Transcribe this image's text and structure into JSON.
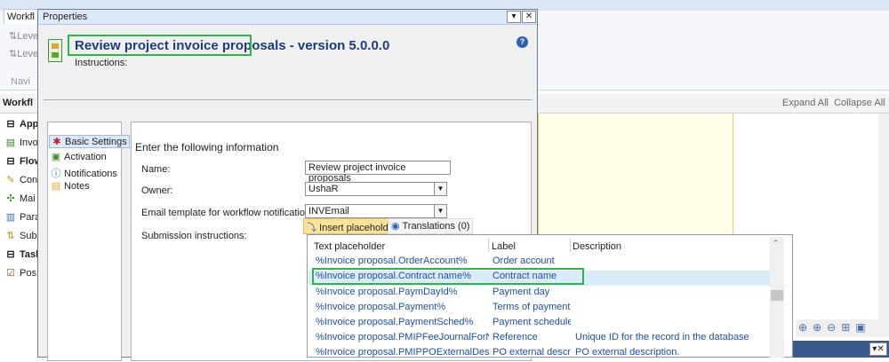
{
  "background": {
    "tab_label": "Workfl",
    "ribbon_items": [
      "Leve",
      "Leve"
    ],
    "nav_label": "Navi",
    "panel_title": "Workfl",
    "expand_all": "Expand All",
    "collapse_all": "Collapse All",
    "tree": [
      {
        "label": "App",
        "bold": true,
        "icon": "minus-box-icon"
      },
      {
        "label": "Invo",
        "bold": false,
        "icon": "document-icon"
      },
      {
        "label": "Flow",
        "bold": true,
        "icon": "minus-box-icon"
      },
      {
        "label": "Con",
        "bold": false,
        "icon": "pencil-icon"
      },
      {
        "label": "Mai",
        "bold": false,
        "icon": "tools-icon"
      },
      {
        "label": "Para",
        "bold": false,
        "icon": "param-icon"
      },
      {
        "label": "Sub",
        "bold": false,
        "icon": "subflow-icon"
      },
      {
        "label": "Task",
        "bold": true,
        "icon": "minus-box-icon"
      },
      {
        "label": "Pos",
        "bold": false,
        "icon": "checkbox-icon"
      }
    ],
    "zoom_icons": [
      "zoom-fit-icon",
      "zoom-in-icon",
      "zoom-out-icon",
      "fit-icon",
      "page-icon"
    ]
  },
  "dialog": {
    "title": "Properties",
    "heading": "Review project invoice proposals",
    "heading_suffix": " - version 5.0.0.0",
    "instructions_label": "Instructions:",
    "nav": [
      {
        "label": "Basic Settings",
        "icon": "star-icon",
        "selected": true
      },
      {
        "label": "Activation",
        "icon": "activation-icon",
        "selected": false
      },
      {
        "label": "Notifications",
        "icon": "info-icon",
        "selected": false
      },
      {
        "label": "Notes",
        "icon": "notes-icon",
        "selected": false
      }
    ],
    "section_title": "Enter the following information",
    "fields": {
      "name_label": "Name:",
      "name_value": "Review project invoice proposals",
      "owner_label": "Owner:",
      "owner_value": "UshaR",
      "email_label": "Email template for workflow notifications:",
      "email_value": "INVEmail",
      "submission_label": "Submission instructions:"
    },
    "toolbar": {
      "insert_placeholder": "Insert placeholder",
      "translations": "Translations (0)"
    }
  },
  "placeholder_list": {
    "headers": {
      "col1": "Text placeholder",
      "col2": "Label",
      "col3": "Description"
    },
    "rows": [
      {
        "placeholder": "%Invoice proposal.OrderAccount%",
        "label": "Order account",
        "description": ""
      },
      {
        "placeholder": "%Invoice proposal.Contract name%",
        "label": "Contract name",
        "description": ""
      },
      {
        "placeholder": "%Invoice proposal.PaymDayId%",
        "label": "Payment day",
        "description": ""
      },
      {
        "placeholder": "%Invoice proposal.Payment%",
        "label": "Terms of payment",
        "description": ""
      },
      {
        "placeholder": "%Invoice proposal.PaymentSched%",
        "label": "Payment schedule",
        "description": ""
      },
      {
        "placeholder": "%Invoice proposal.PMIPFeeJournalForNTE%",
        "label": "Reference",
        "description": "Unique ID for the record in the database"
      },
      {
        "placeholder": "%Invoice proposal.PMIPPOExternalDescripti",
        "label": "PO external descrip",
        "description": "PO external description."
      }
    ]
  }
}
